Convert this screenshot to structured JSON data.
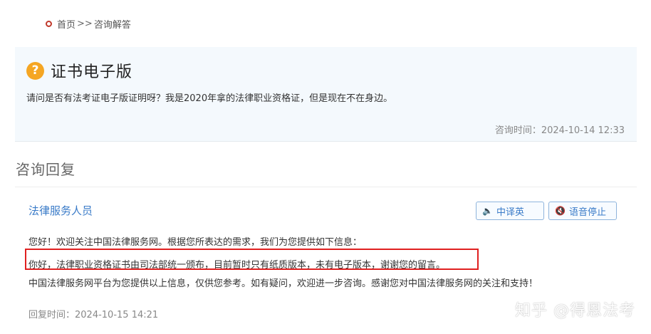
{
  "breadcrumb": {
    "home": "首页",
    "separator": ">>",
    "current": "咨询解答"
  },
  "question": {
    "icon": "question-icon",
    "title": "证书电子版",
    "text": "请问是否有法考证电子版证明呀？我是2020年拿的法律职业资格证，但是现在不在身边。",
    "time_label": "咨询时间：",
    "time_value": "2024-10-14 12:33"
  },
  "answer_section": {
    "title": "咨询回复"
  },
  "answer": {
    "responder": "法律服务人员",
    "translate_button": "中译英",
    "voice_stop_button": "语音停止",
    "line1": "您好！欢迎关注中国法律服务网。根据您所表达的需求，我们为您提供如下信息：",
    "line2": "你好，法律职业资格证书由司法部统一颁布，目前暂时只有纸质版本，未有电子版本，谢谢您的留言。",
    "line3": "中国法律服务网平台为您提供以上信息，仅供您参考。如有疑问，欢迎进一步咨询。感谢您对中国法律服务网的关注和支持！",
    "time_label": "回复时间：",
    "time_value": "2024-10-15 14:21"
  },
  "watermark": "知乎 @得恩法考",
  "colors": {
    "accent_blue": "#3a7bc8",
    "question_icon": "#f5a623",
    "highlight_border": "#e02020",
    "card_bg": "#f4f9fd"
  }
}
